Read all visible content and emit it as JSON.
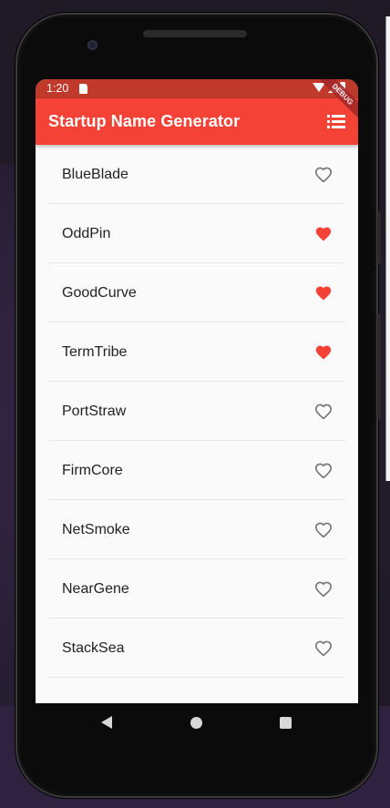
{
  "status_bar": {
    "time": "1:20"
  },
  "app_bar": {
    "title": "Startup Name Generator",
    "debug_label": "DEBUG"
  },
  "colors": {
    "primary": "#f44336",
    "status_bar": "#c0392b",
    "favorite": "#f44336",
    "outline": "#757575"
  },
  "list": {
    "items": [
      {
        "name": "BlueBlade",
        "saved": false
      },
      {
        "name": "OddPin",
        "saved": true
      },
      {
        "name": "GoodCurve",
        "saved": true
      },
      {
        "name": "TermTribe",
        "saved": true
      },
      {
        "name": "PortStraw",
        "saved": false
      },
      {
        "name": "FirmCore",
        "saved": false
      },
      {
        "name": "NetSmoke",
        "saved": false
      },
      {
        "name": "NearGene",
        "saved": false
      },
      {
        "name": "StackSea",
        "saved": false
      },
      {
        "name": "",
        "saved": false
      }
    ]
  },
  "icons": {
    "app_bar_action": "list-icon",
    "saved": "favorite-icon",
    "unsaved": "favorite-border-icon",
    "nav": [
      "back-icon",
      "home-icon",
      "recents-icon"
    ]
  }
}
